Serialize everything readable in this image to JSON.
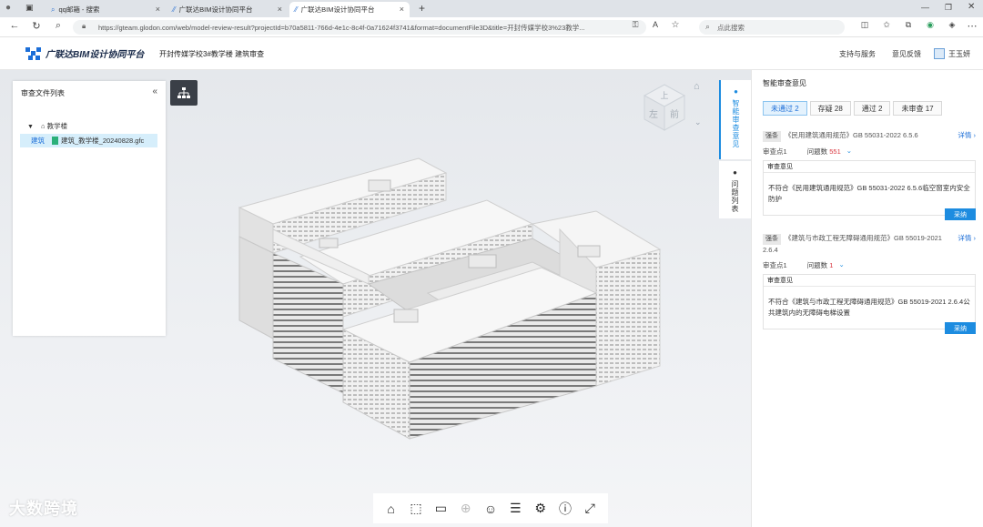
{
  "browser": {
    "tabs": [
      {
        "label": "qq邮箱 - 搜索",
        "icon": "search-icon"
      },
      {
        "label": "广联达BIM设计协同平台",
        "icon": "glodon-icon"
      },
      {
        "label": "广联达BIM设计协同平台",
        "icon": "glodon-icon"
      }
    ],
    "url": "https://gteam.glodon.com/web/model-review-result?projectId=b70a5811-766d-4e1c-8c4f-0a71624f3741&format=documentFile3D&title=开封传媒学校3%23教学...",
    "search_placeholder": "点此搜索",
    "new_tab": "+"
  },
  "app": {
    "logo_text": "广联达BIM设计协同平台",
    "breadcrumb": "开封传媒学校3#教学楼 建筑审查",
    "header_links": [
      "支持与服务",
      "意见反馈"
    ],
    "user_name": "王玉妍"
  },
  "file_panel": {
    "title": "审查文件列表",
    "collapse": "«",
    "tree_root": "教学楼",
    "file_tag": "建筑",
    "file_name": "建筑_教学楼_20240828.gfc"
  },
  "viewcube": {
    "left": "左",
    "front": "前",
    "top": "上"
  },
  "side_tabs": [
    {
      "label": "智能审查意见"
    },
    {
      "label": "问题列表"
    }
  ],
  "review_panel": {
    "title": "智能审查意见",
    "filters": [
      {
        "label": "未通过 2"
      },
      {
        "label": "存疑 28"
      },
      {
        "label": "通过 2"
      },
      {
        "label": "未审查 17"
      }
    ],
    "issues": [
      {
        "clause_tag": "强条",
        "clause": "《民用建筑通用规范》GB 55031-2022 6.5.6",
        "detail": "详情",
        "point": "审查点1",
        "problems_label": "问题数",
        "problems": "551",
        "box_title": "审查意见",
        "opinion": "不符合《民用建筑通用规范》GB 55031-2022 6.5.6临空窗室内安全防护",
        "adopt": "采纳"
      },
      {
        "clause_tag": "强条",
        "clause": "《建筑与市政工程无障碍通用规范》GB 55019-2021 2.6.4",
        "detail": "详情",
        "point": "审查点1",
        "problems_label": "问题数",
        "problems": "1",
        "box_title": "审查意见",
        "opinion": "不符合《建筑与市政工程无障碍通用规范》GB 55019-2021 2.6.4公共建筑内的无障碍电梯设置",
        "adopt": "采纳"
      }
    ]
  },
  "toolbar_icons": [
    "home-icon",
    "section-box-icon",
    "measure-icon",
    "explode-icon",
    "person-icon",
    "properties-icon",
    "settings-icon",
    "info-icon",
    "fullscreen-icon"
  ],
  "watermark": "大数跨境",
  "colors": {
    "accent": "#1d8ce0",
    "danger": "#d9363e",
    "toolbar_dark": "#3a3f47"
  }
}
